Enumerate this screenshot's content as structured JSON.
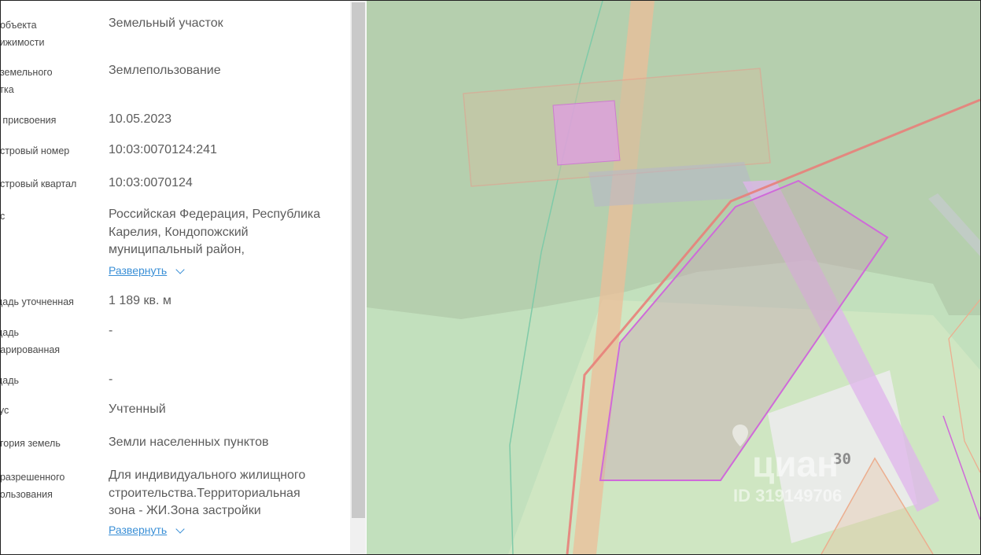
{
  "properties": [
    {
      "label": ", объекта\nвижимости",
      "value": "Земельный участок"
    },
    {
      "label": ", земельного\nстка",
      "value": "Землепользование"
    },
    {
      "label": "а присвоения",
      "value": "10.05.2023"
    },
    {
      "label": "астровый номер",
      "value": "10:03:0070124:241"
    },
    {
      "label": "астровый квартал",
      "value": "10:03:0070124"
    },
    {
      "label": "ес",
      "value": "Российская Федерация, Республика Карелия, Кондопожский муниципальный район,"
    },
    {
      "label": "щадь уточненная",
      "value": "1 189 кв. м"
    },
    {
      "label": "щадь\nларированная",
      "value": "-"
    },
    {
      "label": "щадь",
      "value": "-"
    },
    {
      "label": "тус",
      "value": "Учтенный"
    },
    {
      "label": "егория земель",
      "value": "Земли населенных пунктов"
    },
    {
      "label": ", разрешенного\nпользования",
      "value": "Для индивидуального жилищного строительства.Территориальная зона - ЖИ.Зона застройки"
    }
  ],
  "expand_links": {
    "address": "Развернуть",
    "permitted_use": "Развернуть"
  },
  "map": {
    "house_number": "30",
    "watermark_brand": "циан",
    "watermark_id": "ID 319149706",
    "colors": {
      "forest": "#b5cfae",
      "field": "#c2e0bd",
      "parcel_outline": "#cf6ad9",
      "road": "#ecbe98",
      "boundary": "#e8807a"
    }
  }
}
